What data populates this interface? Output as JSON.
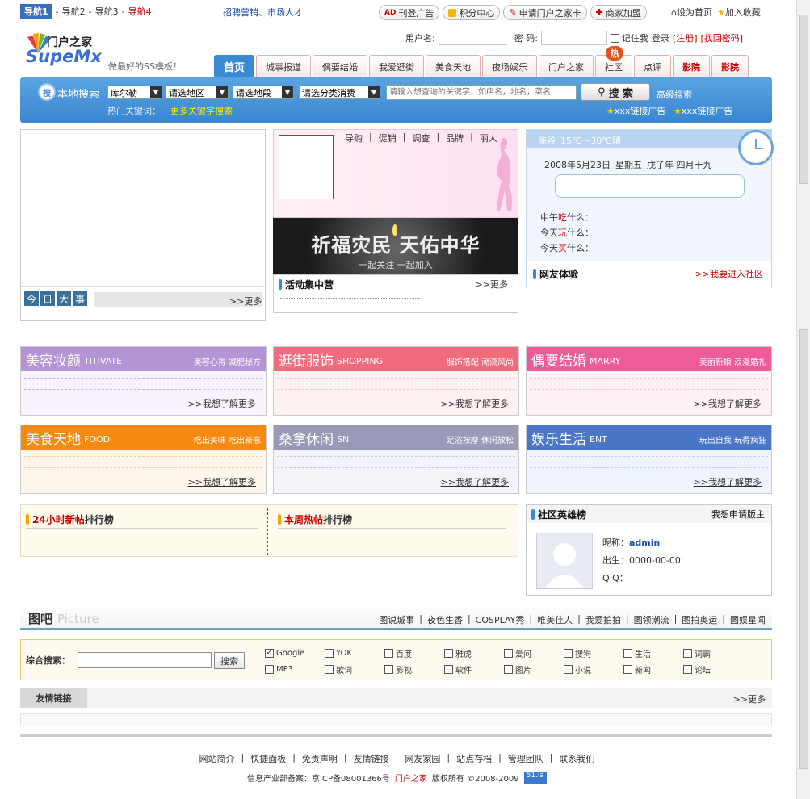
{
  "topnav": {
    "current": "导航1",
    "items": [
      "导航2",
      "导航3",
      "导航4"
    ],
    "recruit": "招聘营销、市场人才"
  },
  "topbtns": [
    {
      "icon": "ad-icon",
      "label": "刊登广告"
    },
    {
      "icon": "coin-icon",
      "label": "积分中心"
    },
    {
      "icon": "pen-icon",
      "label": "申请门户之家卡"
    },
    {
      "icon": "plus-icon",
      "label": "商家加盟"
    }
  ],
  "toplinks": {
    "home": "设为首页",
    "fav": "加入收藏"
  },
  "logo": {
    "cn": "门户之家",
    "en": "SupeMx",
    "slogan": "做最好的SS模板！"
  },
  "login": {
    "user_label": "用户名:",
    "pass_label": "密   码:",
    "remember": "记住我",
    "login": "登录",
    "register": "[注册]",
    "forgot": "[找回密码]"
  },
  "tabs": [
    "首页",
    "城事报道",
    "偶要结婚",
    "我爱逛街",
    "美食天地",
    "夜场娱乐",
    "门户之家",
    "社区",
    "点评",
    "影院",
    "影院"
  ],
  "hot_badge": "热",
  "search": {
    "label": "本地搜索",
    "city": "库尔勒",
    "area": "请选地区",
    "seg": "请选地段",
    "cat": "请选分类消费",
    "placeholder": "请输入想查询的关键字，如店名，地名，菜名",
    "btn": "搜 索",
    "adv": "高级搜索",
    "hot_label": "热门关键词：",
    "hot_more": "更多关键字搜索",
    "ad1": "xxx链接广告",
    "ad2": "xxx链接广告"
  },
  "today": {
    "chars": [
      "今",
      "日",
      "大",
      "事"
    ],
    "more": ">>更多"
  },
  "promo": {
    "links": [
      "导购",
      "促销",
      "调查",
      "品牌",
      "丽人"
    ],
    "banner_main": "祈福灾民  天佑中华",
    "banner_sub": "一起关注   一起加入"
  },
  "activity": {
    "title": "活动集中营",
    "more": ">>更多"
  },
  "weather": {
    "city": "临谷",
    "temp": "15℃～30℃",
    "cond": "晴",
    "date": "2008年5月23日",
    "week": "星期五",
    "lunar": "戊子年 四月十九",
    "q1a": "中午",
    "q1b": "吃",
    "q1c": "什么：",
    "q2a": "今天",
    "q2b": "玩",
    "q2c": "什么：",
    "q3a": "今天",
    "q3b": "买",
    "q3c": "什么："
  },
  "netfriend": {
    "title": "网友体验",
    "more": ">>我要进入社区"
  },
  "cats": [
    {
      "zh": "美容妆颜",
      "en": "TITIVATE",
      "sub": "美容心得  减肥秘方",
      "more": ">>我想了解更多",
      "color": "#b494d4",
      "bg": "#f7f2fb"
    },
    {
      "zh": "逛街服饰",
      "en": "SHOPPING",
      "sub": "服饰搭配  潮流风尚",
      "more": ">>我想了解更多",
      "color": "#f26b7d",
      "bg": "#fdf1f2"
    },
    {
      "zh": "偶要结婚",
      "en": "MARRY",
      "sub": "美丽新娘  浪漫婚礼",
      "more": ">>我想了解更多",
      "color": "#ee5b97",
      "bg": "#fdf1f6"
    },
    {
      "zh": "美食天地",
      "en": "FOOD",
      "sub": "吃出美味  吃出新意",
      "more": ">>我想了解更多",
      "color": "#f58a10",
      "bg": "#fef6ea"
    },
    {
      "zh": "桑拿休闲",
      "en": "SN",
      "sub": "足浴按摩  休闲放松",
      "more": ">>我想了解更多",
      "color": "#9a9ab8",
      "bg": "#f3f4fa"
    },
    {
      "zh": "娱乐生活",
      "en": "ENT",
      "sub": "玩出自我  玩得疯狂",
      "more": ">>我想了解更多",
      "color": "#4a76c8",
      "bg": "#eff3fb"
    }
  ],
  "rank": {
    "a1": "24小时",
    "a2": "新帖",
    "a3": "排行榜",
    "b1": "本周",
    "b2": "热帖",
    "b3": "排行榜"
  },
  "hero": {
    "title": "社区英雄榜",
    "apply": "我想申请版主",
    "nick_label": "昵称：",
    "nick": "admin",
    "birth_label": "出生：",
    "birth": "0000-00-00",
    "qq_label": "Q  Q："
  },
  "picture": {
    "cn": "图吧",
    "en": "Picture",
    "links": [
      "图说城事",
      "夜色生香",
      "COSPLAY秀",
      "唯美佳人",
      "我爱拍拍",
      "图领潮流",
      "图拍奥运",
      "图娱星闻"
    ]
  },
  "combo": {
    "label": "综合搜索：",
    "btn": "搜索",
    "opts": [
      [
        "Google",
        true
      ],
      [
        "YOK",
        false
      ],
      [
        "百度",
        false
      ],
      [
        "雅虎",
        false
      ],
      [
        "爱问",
        false
      ],
      [
        "搜狗",
        false
      ],
      [
        "生活",
        false
      ],
      [
        "词霸",
        false
      ],
      [
        "MP3",
        false
      ],
      [
        "歌词",
        false
      ],
      [
        "影视",
        false
      ],
      [
        "软件",
        false
      ],
      [
        "图片",
        false
      ],
      [
        "小说",
        false
      ],
      [
        "新闻",
        false
      ],
      [
        "论坛",
        false
      ]
    ]
  },
  "friend": {
    "title": "友情链接",
    "more": ">>更多"
  },
  "footer": {
    "links": [
      "网站简介",
      "快捷面板",
      "免责声明",
      "友情链接",
      "网友家园",
      "站点存档",
      "管理团队",
      "联系我们"
    ],
    "icp_pre": "信息产业部备案：京ICP备08001366号",
    "brand": "门户之家",
    "rights": "版权所有 ©2008-2009",
    "badge": "51.la"
  },
  "colors": {
    "accent": "#3a8ad2",
    "red": "#cc0000"
  }
}
